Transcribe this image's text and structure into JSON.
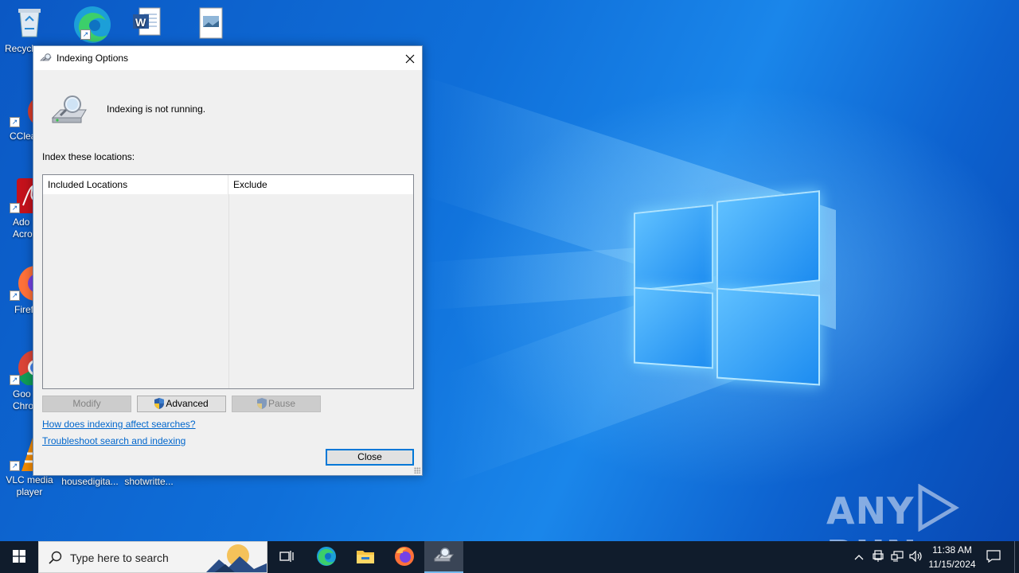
{
  "desktop": {
    "icons": [
      {
        "label": "Recycl"
      },
      {
        "label": ""
      },
      {
        "label": ""
      },
      {
        "label": ""
      },
      {
        "label": "CClea"
      },
      {
        "label": "Ado\nAcro"
      },
      {
        "label": "Firef"
      },
      {
        "label": "Goo\nChro"
      },
      {
        "label": "VLC media\nplayer"
      },
      {
        "label": "housedigita..."
      },
      {
        "label": "shotwritte..."
      }
    ],
    "watermark": "ANY RUN"
  },
  "dialog": {
    "title": "Indexing Options",
    "status": "Indexing is not running.",
    "section_label": "Index these locations:",
    "list": {
      "columns": [
        "Included Locations",
        "Exclude"
      ],
      "rows": []
    },
    "buttons": {
      "modify": "Modify",
      "advanced": "Advanced",
      "pause": "Pause",
      "close": "Close"
    },
    "links": {
      "help": "How does indexing affect searches?",
      "troubleshoot": "Troubleshoot search and indexing"
    }
  },
  "taskbar": {
    "search_placeholder": "Type here to search",
    "clock": {
      "time": "11:38 AM",
      "date": "11/15/2024"
    }
  },
  "colors": {
    "accent": "#0078d7",
    "link": "#0066cc",
    "taskbar": "#101c2c"
  }
}
